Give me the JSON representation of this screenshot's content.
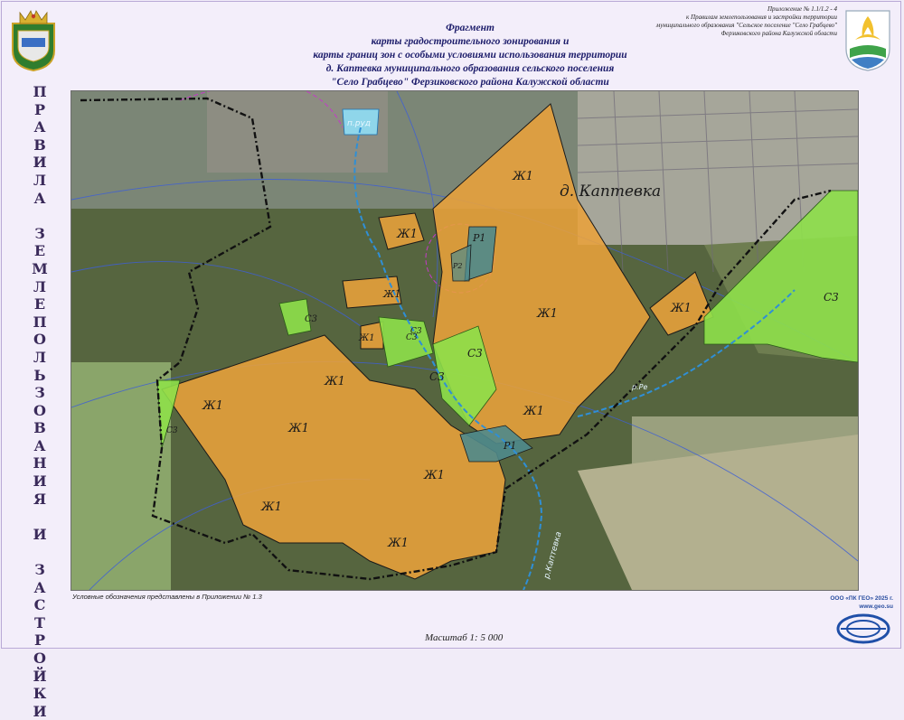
{
  "title": {
    "line1": "Фрагмент",
    "line2": "карты градостроительного зонирования  и",
    "line3": "карты границ зон с особыми условиями использования территории",
    "line4": "д. Каптевка муниципального образования сельского поселения",
    "line5": "\"Село Грабцево\" Ферзиковского района Калужской области"
  },
  "appendix": {
    "line1": "Приложение № 1.1/1.2 - 4",
    "line2": "к Правилам землепользования и застройки территории",
    "line3": "муниципального образования \"Сельское поселение \"Село Грабцево\"",
    "line4": "Ферзиковского района Калужской области"
  },
  "side_title": [
    "П",
    "Р",
    "А",
    "В",
    "И",
    "Л",
    "А",
    " ",
    "З",
    "Е",
    "М",
    "Л",
    "Е",
    "П",
    "О",
    "Л",
    "Ь",
    "З",
    "О",
    "В",
    "А",
    "Н",
    "И",
    "Я",
    " ",
    "И",
    " ",
    "З",
    "А",
    "С",
    "Т",
    "Р",
    "О",
    "Й",
    "К",
    "И"
  ],
  "map": {
    "village_label": "д. Каптевка",
    "pond_label": "п.руд",
    "river_labels": [
      "р.Ре",
      "р.Каптевка"
    ],
    "zone_labels": {
      "zh1": "Ж1",
      "r1": "Р1",
      "r2": "Р2",
      "s3": "С3"
    },
    "colors": {
      "zh1_fill": "#e9a23b",
      "s3_fill": "#8ee04a",
      "r_fill": "#4f8a8c",
      "boundary": "#111111",
      "water": "#2f8fd6",
      "pond": "#8fd6ea"
    }
  },
  "footer": {
    "legend_note": "Условные обозначения представлены в Приложении № 1.3",
    "scale": "Масштаб 1: 5 000",
    "company_line1": "ООО «ПК ГЕО» 2025 г.",
    "company_line2": "www.geo.su"
  }
}
